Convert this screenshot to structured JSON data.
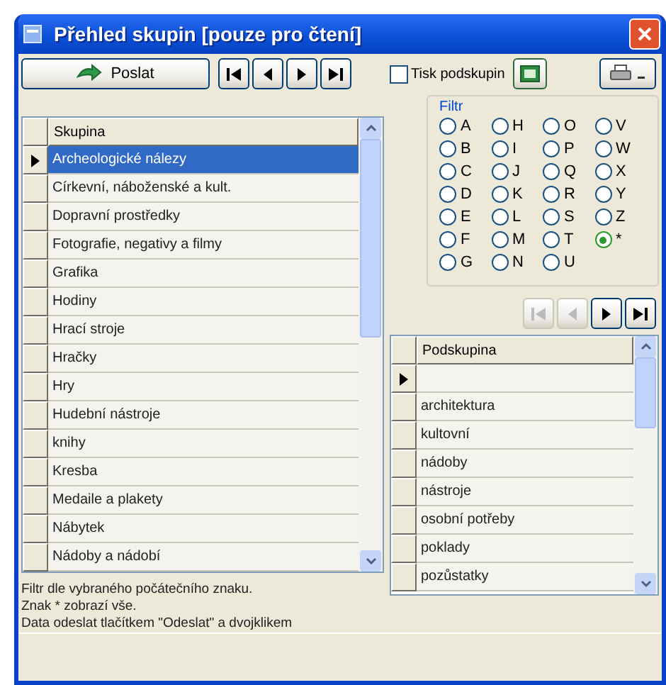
{
  "window": {
    "title": "Přehled skupin [pouze pro čtení]"
  },
  "toolbar": {
    "send_button": "Poslat",
    "nav_buttons": [
      {
        "kind": "first",
        "disabled": false
      },
      {
        "kind": "prev",
        "disabled": false
      },
      {
        "kind": "next",
        "disabled": false
      },
      {
        "kind": "last",
        "disabled": false
      }
    ]
  },
  "print_subgroups": {
    "label": "Tisk podskupin",
    "checked": false
  },
  "filter": {
    "title": "Filtr",
    "options": [
      {
        "label": "A",
        "selected": false
      },
      {
        "label": "B",
        "selected": false
      },
      {
        "label": "C",
        "selected": false
      },
      {
        "label": "D",
        "selected": false
      },
      {
        "label": "E",
        "selected": false
      },
      {
        "label": "F",
        "selected": false
      },
      {
        "label": "G",
        "selected": false
      },
      {
        "label": "H",
        "selected": false
      },
      {
        "label": "I",
        "selected": false
      },
      {
        "label": "J",
        "selected": false
      },
      {
        "label": "K",
        "selected": false
      },
      {
        "label": "L",
        "selected": false
      },
      {
        "label": "M",
        "selected": false
      },
      {
        "label": "N",
        "selected": false
      },
      {
        "label": "O",
        "selected": false
      },
      {
        "label": "P",
        "selected": false
      },
      {
        "label": "Q",
        "selected": false
      },
      {
        "label": "R",
        "selected": false
      },
      {
        "label": "S",
        "selected": false
      },
      {
        "label": "T",
        "selected": false
      },
      {
        "label": "U",
        "selected": false
      },
      {
        "label": "V",
        "selected": false
      },
      {
        "label": "W",
        "selected": false
      },
      {
        "label": "X",
        "selected": false
      },
      {
        "label": "Y",
        "selected": false
      },
      {
        "label": "Z",
        "selected": false
      },
      {
        "label": "*",
        "selected": true
      }
    ]
  },
  "subgroup_nav": [
    {
      "kind": "first",
      "disabled": true
    },
    {
      "kind": "prev",
      "disabled": true
    },
    {
      "kind": "next",
      "disabled": false
    },
    {
      "kind": "last",
      "disabled": false
    }
  ],
  "groups_table": {
    "column": "Skupina",
    "rows": [
      {
        "name": "Archeologické nálezy",
        "selected": true
      },
      {
        "name": "Církevní, náboženské a kult.",
        "selected": false
      },
      {
        "name": "Dopravní prostředky",
        "selected": false
      },
      {
        "name": "Fotografie, negativy a filmy",
        "selected": false
      },
      {
        "name": "Grafika",
        "selected": false
      },
      {
        "name": "Hodiny",
        "selected": false
      },
      {
        "name": "Hrací stroje",
        "selected": false
      },
      {
        "name": "Hračky",
        "selected": false
      },
      {
        "name": "Hry",
        "selected": false
      },
      {
        "name": "Hudební nástroje",
        "selected": false
      },
      {
        "name": "knihy",
        "selected": false
      },
      {
        "name": "Kresba",
        "selected": false
      },
      {
        "name": "Medaile a plakety",
        "selected": false
      },
      {
        "name": "Nábytek",
        "selected": false
      },
      {
        "name": "Nádoby a nádobí",
        "selected": false
      }
    ]
  },
  "subgroups_table": {
    "column": "Podskupina",
    "rows": [
      {
        "name": "",
        "selected": true
      },
      {
        "name": "architektura",
        "selected": false
      },
      {
        "name": "kultovní",
        "selected": false
      },
      {
        "name": "nádoby",
        "selected": false
      },
      {
        "name": "nástroje",
        "selected": false
      },
      {
        "name": "osobní potřeby",
        "selected": false
      },
      {
        "name": "poklady",
        "selected": false
      },
      {
        "name": "pozůstatky",
        "selected": false
      }
    ]
  },
  "help_lines": [
    "Filtr dle vybraného počátečního znaku.",
    "Znak * zobrazí vše.",
    "Data odeslat tlačítkem \"Odeslat\" a dvojklikem"
  ]
}
